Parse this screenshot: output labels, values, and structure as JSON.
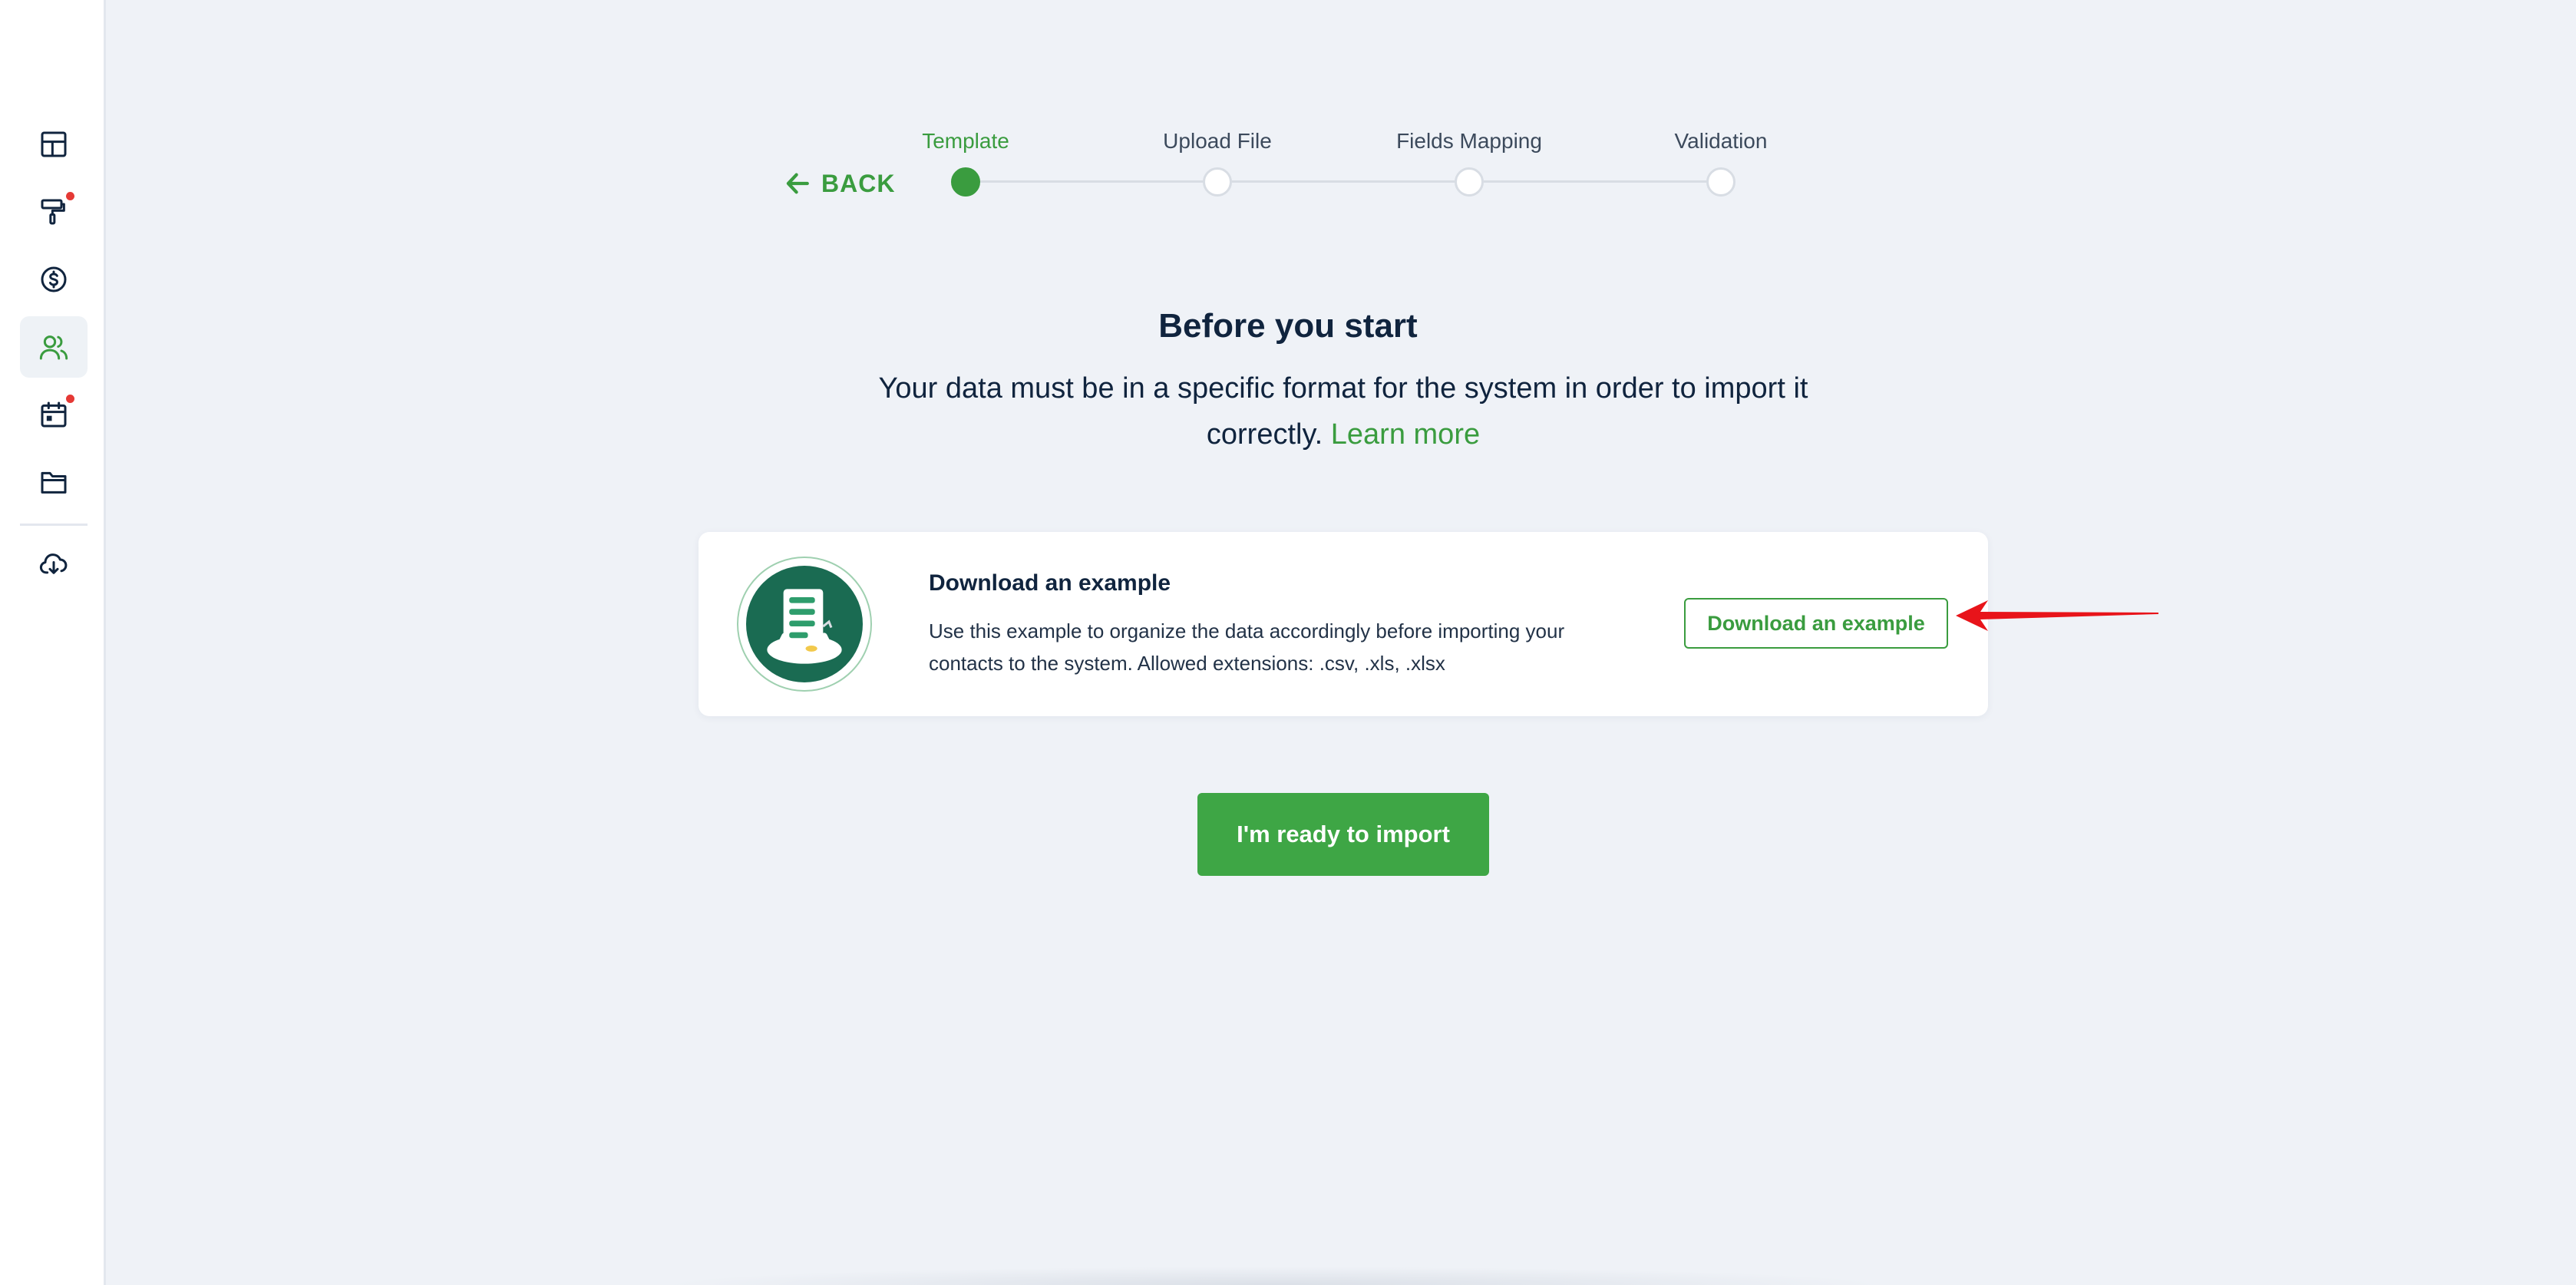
{
  "colors": {
    "accent": "#3a9c3f",
    "primary_button": "#3ea645",
    "background": "#eff2f7",
    "notification_dot": "#e53935",
    "annotation_arrow": "#e8141a"
  },
  "sidebar": {
    "items": [
      {
        "icon": "dashboard-icon",
        "active": false,
        "badge": false
      },
      {
        "icon": "paint-roller-icon",
        "active": false,
        "badge": true
      },
      {
        "icon": "dollar-icon",
        "active": false,
        "badge": false
      },
      {
        "icon": "contacts-icon",
        "active": true,
        "badge": false
      },
      {
        "icon": "calendar-icon",
        "active": false,
        "badge": true
      },
      {
        "icon": "folder-icon",
        "active": false,
        "badge": false
      },
      {
        "icon": "cloud-download-icon",
        "active": false,
        "badge": false
      }
    ]
  },
  "stepper": {
    "back_label": "BACK",
    "current_step": 1,
    "steps": [
      {
        "label": "Template",
        "active": true
      },
      {
        "label": "Upload File",
        "active": false
      },
      {
        "label": "Fields Mapping",
        "active": false
      },
      {
        "label": "Validation",
        "active": false
      }
    ]
  },
  "intro": {
    "title": "Before you start",
    "text": "Your data must be in a specific format for the system in order to import it correctly.",
    "link": "Learn more"
  },
  "example_card": {
    "illustration_icon": "spreadsheet-document-icon",
    "title": "Download an example",
    "description": "Use this example to organize the data accordingly before importing your contacts to the system. Allowed extensions: .csv, .xls, .xlsx",
    "button_label": "Download an example"
  },
  "primary_action": {
    "label": "I'm ready to import"
  }
}
